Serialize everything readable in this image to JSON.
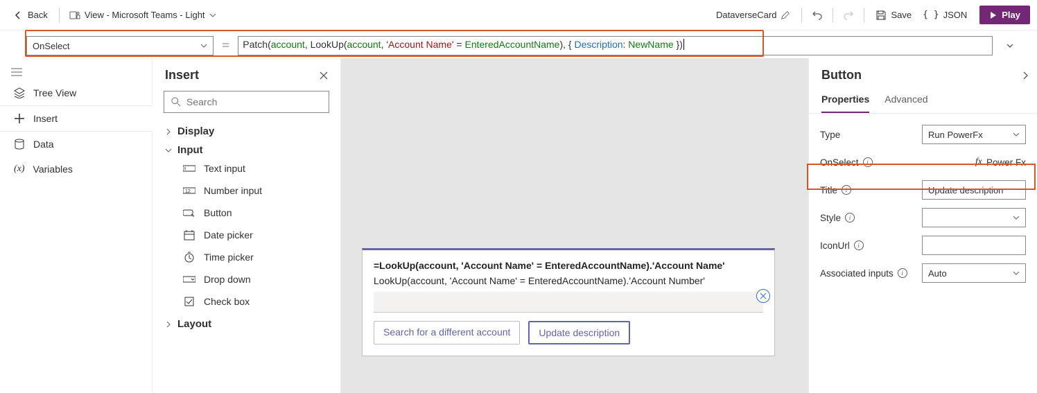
{
  "topbar": {
    "back": "Back",
    "view_label": "View - Microsoft Teams - Light",
    "card_name": "DataverseCard",
    "save": "Save",
    "json": "JSON",
    "play": "Play"
  },
  "formula": {
    "property": "OnSelect",
    "expr_fn1": "Patch",
    "expr_open": "(",
    "expr_id1": "account",
    "expr_c1": ", ",
    "expr_fn2": "LookUp",
    "expr_open2": "(",
    "expr_id2": "account",
    "expr_c2": ", ",
    "expr_str": "'Account Name'",
    "expr_eq": " = ",
    "expr_id3": "EnteredAccountName",
    "expr_close1": "), { ",
    "expr_prop": "Description",
    "expr_colon": ": ",
    "expr_id4": "NewName",
    "expr_end": " })"
  },
  "leftnav": {
    "tree": "Tree View",
    "insert": "Insert",
    "data": "Data",
    "vars": "Variables"
  },
  "insert": {
    "title": "Insert",
    "search_placeholder": "Search",
    "groups": {
      "display": "Display",
      "input": "Input",
      "layout": "Layout"
    },
    "controls": {
      "text_input": "Text input",
      "number_input": "Number input",
      "button": "Button",
      "date_picker": "Date picker",
      "time_picker": "Time picker",
      "drop_down": "Drop down",
      "check_box": "Check box"
    }
  },
  "card": {
    "line1": "=LookUp(account, 'Account Name' = EnteredAccountName).'Account Name'",
    "line2": "LookUp(account, 'Account Name' = EnteredAccountName).'Account Number'",
    "btn_search": "Search for a different account",
    "btn_update": "Update description"
  },
  "props": {
    "heading": "Button",
    "tabs": {
      "properties": "Properties",
      "advanced": "Advanced"
    },
    "rows": {
      "type_label": "Type",
      "type_value": "Run PowerFx",
      "onselect_label": "OnSelect",
      "onselect_value": "Power Fx",
      "title_label": "Title",
      "title_value": "Update description",
      "style_label": "Style",
      "iconurl_label": "IconUrl",
      "assoc_label": "Associated inputs",
      "assoc_value": "Auto"
    }
  }
}
